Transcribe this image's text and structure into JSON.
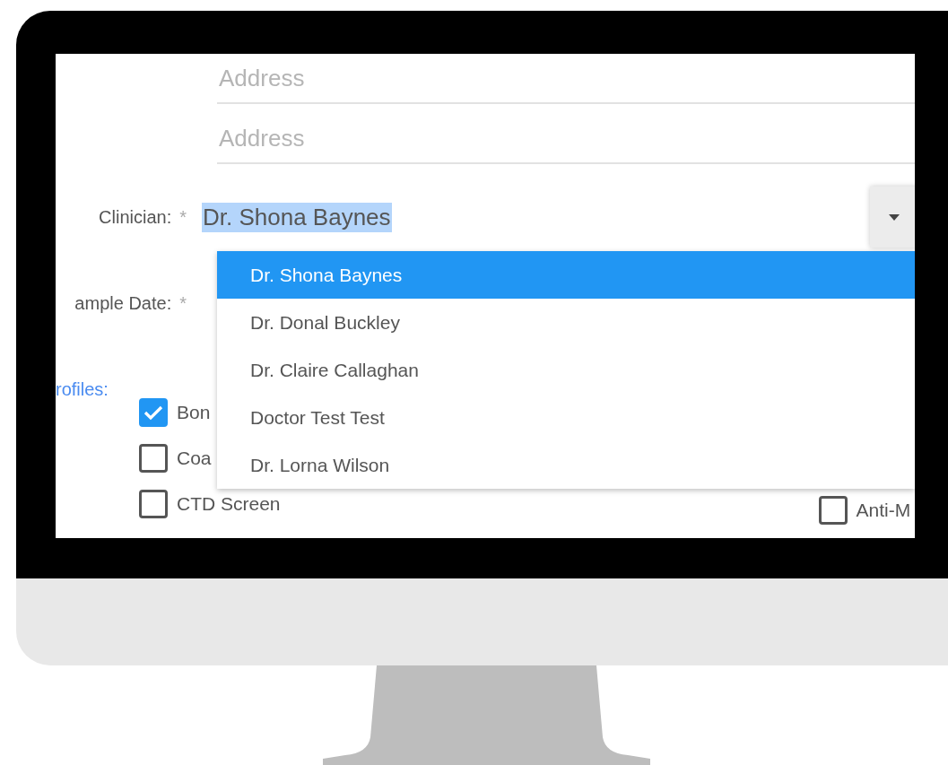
{
  "address_fields": [
    {
      "placeholder": "Address"
    },
    {
      "placeholder": "Address"
    }
  ],
  "clinician": {
    "label": "Clinician:",
    "required_mark": "*",
    "value": "Dr. Shona Baynes",
    "value_highlighted": true,
    "dropdown": {
      "expanded": true,
      "options": [
        {
          "label": "Dr. Shona Baynes",
          "selected": true
        },
        {
          "label": "Dr. Donal Buckley",
          "selected": false
        },
        {
          "label": "Dr. Claire Callaghan",
          "selected": false
        },
        {
          "label": "Doctor Test Test",
          "selected": false
        },
        {
          "label": "Dr. Lorna Wilson",
          "selected": false
        }
      ]
    }
  },
  "sample_date": {
    "label": "ample Date:",
    "required_mark": "*"
  },
  "profiles": {
    "heading": "rofiles:",
    "rows": [
      {
        "items": [
          {
            "label": "Bon",
            "checked": true
          }
        ]
      },
      {
        "items": [
          {
            "label": "Coa",
            "checked": false
          }
        ]
      },
      {
        "items": [
          {
            "label": "CTD Screen",
            "checked": false
          },
          {
            "label": "Anti-M",
            "checked": false
          }
        ]
      }
    ]
  }
}
